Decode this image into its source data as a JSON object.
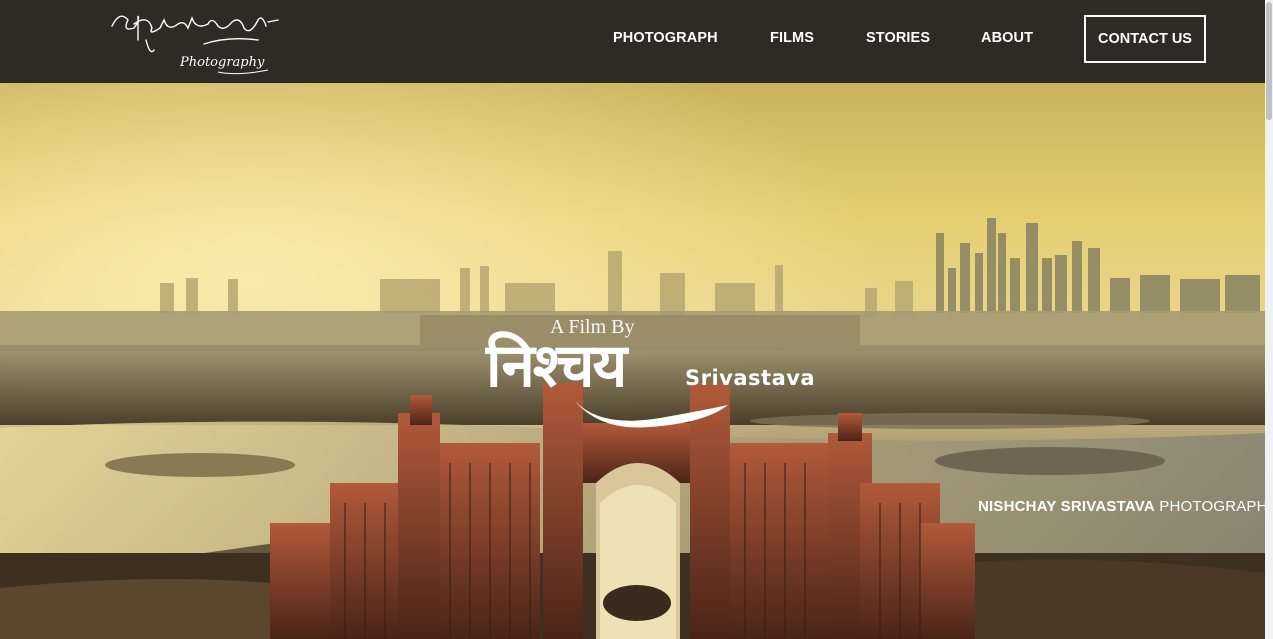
{
  "logo": {
    "signature": "Nishchay Srivastava",
    "tagline": "Photography"
  },
  "nav": {
    "items": [
      {
        "label": "PHOTOGRAPH"
      },
      {
        "label": "FILMS"
      },
      {
        "label": "STORIES"
      },
      {
        "label": "ABOUT"
      }
    ],
    "contact_label": "CONTACT US"
  },
  "hero": {
    "intro": "A Film By",
    "name_devanagari": "निश्चय",
    "surname": "Srivastava",
    "watermark_name": "NISHCHAY SRIVASTAVA",
    "watermark_suffix": "PHOTOGRAPHY"
  },
  "colors": {
    "navbar_bg": "#2e2c22",
    "nav_text": "#ffffff",
    "sky_top": "#c9b45a",
    "sky_glow": "#f3df86",
    "hotel": "#8a3f2c"
  }
}
